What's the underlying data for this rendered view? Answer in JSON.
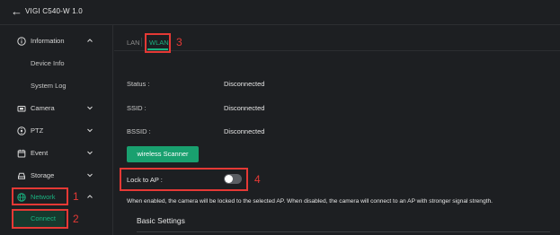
{
  "header": {
    "back_icon": "arrow-left-icon",
    "title": "VIGI C540-W 1.0"
  },
  "sidebar": {
    "items": [
      {
        "label": "Information",
        "icon": "info-icon",
        "chevron": "up"
      },
      {
        "label": "Device Info"
      },
      {
        "label": "System Log"
      },
      {
        "label": "Camera",
        "icon": "camera-icon",
        "chevron": "down"
      },
      {
        "label": "PTZ",
        "icon": "ptz-icon",
        "chevron": "down"
      },
      {
        "label": "Event",
        "icon": "calendar-icon",
        "chevron": "down"
      },
      {
        "label": "Storage",
        "icon": "storage-icon",
        "chevron": "down"
      },
      {
        "label": "Network",
        "icon": "globe-icon",
        "chevron": "up"
      },
      {
        "label": "Connect"
      }
    ]
  },
  "tabs": [
    {
      "label": "LAN"
    },
    {
      "label": "WLAN"
    }
  ],
  "wlan": {
    "status_label": "Status :",
    "status_value": "Disconnected",
    "ssid_label": "SSID :",
    "ssid_value": "Disconnected",
    "bssid_label": "BSSID :",
    "bssid_value": "Disconnected",
    "scan_button": "wireless Scanner",
    "lock_label": "Lock to AP :",
    "lock_enabled": false,
    "lock_note": "When enabled, the camera will be locked to the selected AP. When disabled, the camera will connect to an AP with stronger signal strength.",
    "section_title": "Basic Settings"
  },
  "annotations": {
    "n1": "1",
    "n2": "2",
    "n3": "3",
    "n4": "4"
  },
  "colors": {
    "accent": "#19b380",
    "annotation": "#e53935",
    "background": "#1d1f22"
  }
}
